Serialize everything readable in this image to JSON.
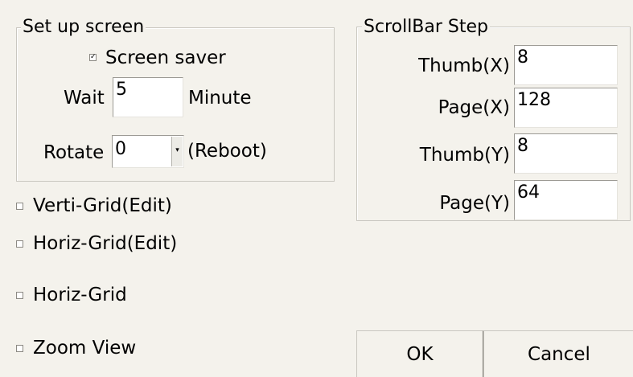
{
  "setup": {
    "legend": "Set up screen",
    "screen_saver_label": "Screen saver",
    "screen_saver_checked": true,
    "wait_label": "Wait",
    "wait_value": "5",
    "minute_label": "Minute",
    "rotate_label": "Rotate",
    "rotate_value": "0",
    "reboot_label": "(Reboot)"
  },
  "scrollbar": {
    "legend": "ScrollBar Step",
    "thumb_x_label": "Thumb(X)",
    "thumb_x_value": "8",
    "page_x_label": "Page(X)",
    "page_x_value": "128",
    "thumb_y_label": "Thumb(Y)",
    "thumb_y_value": "8",
    "page_y_label": "Page(Y)",
    "page_y_value": "64"
  },
  "options": {
    "verti_grid_edit": "Verti-Grid(Edit)",
    "horiz_grid_edit": "Horiz-Grid(Edit)",
    "horiz_grid": "Horiz-Grid",
    "zoom_view": "Zoom View"
  },
  "buttons": {
    "ok": "OK",
    "cancel": "Cancel"
  }
}
